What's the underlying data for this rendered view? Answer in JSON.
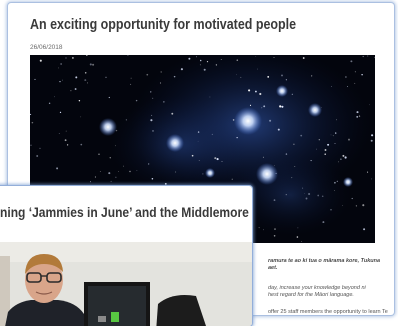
{
  "back_article": {
    "title": "An exciting opportunity for motivated people",
    "date": "26/06/2018",
    "body_lines": [
      "ramura te ao ki tua o mārama kore, Tukuna",
      "aet.",
      "day, increase your knowledge beyond ni",
      "hest regard for the Māori language.",
      "offer 25 staff members the opportunity to learn Te",
      ""
    ]
  },
  "front_article": {
    "title": "ning ‘Jammies in June’ and the Middlemore"
  }
}
